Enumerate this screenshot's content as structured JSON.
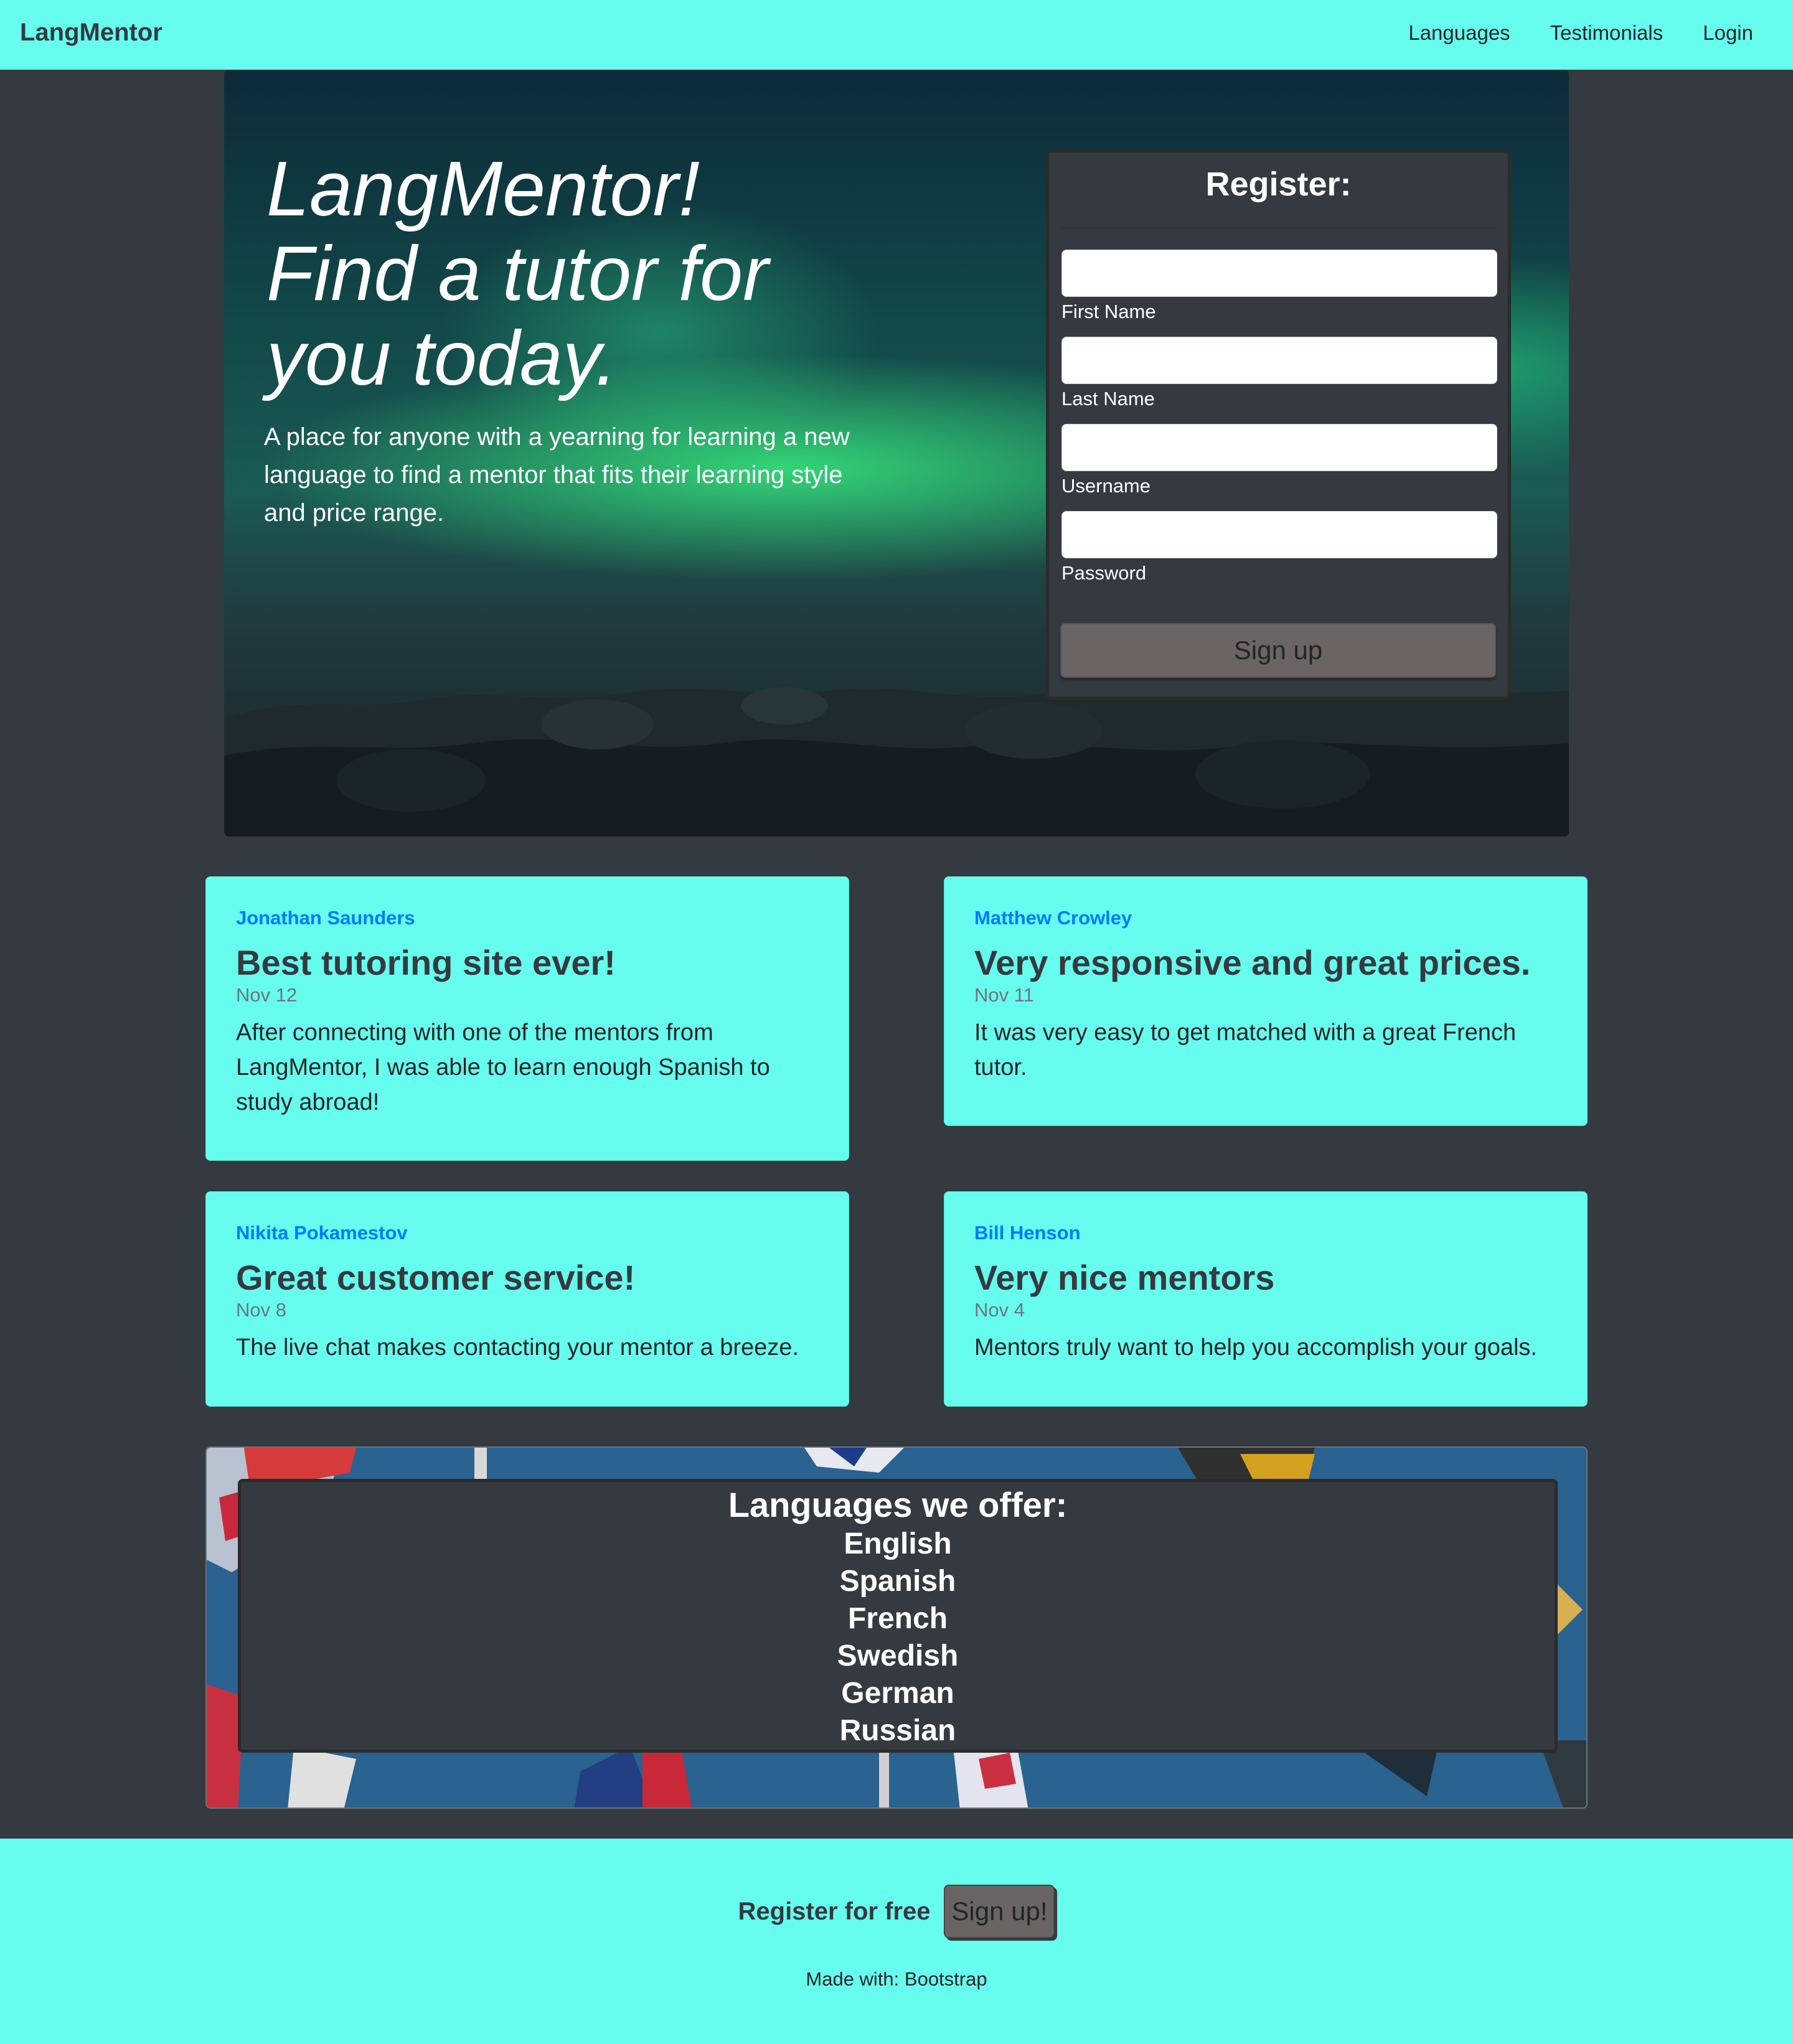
{
  "navbar": {
    "brand": "LangMentor",
    "links": [
      "Languages",
      "Testimonials",
      "Login"
    ]
  },
  "hero": {
    "title": "LangMentor! Find a tutor for you today.",
    "subtitle": "A place for anyone with a yearning for learning a new language to find a mentor that fits their learning style and price range."
  },
  "register": {
    "title": "Register:",
    "fields": [
      "First Name",
      "Last Name",
      "Username",
      "Password"
    ],
    "button": "Sign up"
  },
  "testimonials": [
    {
      "author": "Jonathan Saunders",
      "title": "Best tutoring site ever!",
      "date": "Nov 12",
      "text": "After connecting with one of the mentors from LangMentor, I was able to learn enough Spanish to study abroad!"
    },
    {
      "author": "Matthew Crowley",
      "title": "Very responsive and great prices.",
      "date": "Nov 11",
      "text": "It was very easy to get matched with a great French tutor."
    },
    {
      "author": "Nikita Pokamestov",
      "title": "Great customer service!",
      "date": "Nov 8",
      "text": "The live chat makes contacting your mentor a breeze."
    },
    {
      "author": "Bill Henson",
      "title": "Very nice mentors",
      "date": "Nov 4",
      "text": "Mentors truly want to help you accomplish your goals."
    }
  ],
  "languages": {
    "title": "Languages we offer:",
    "items": [
      "English",
      "Spanish",
      "French",
      "Swedish",
      "German",
      "Russian"
    ]
  },
  "footer": {
    "cta_text": "Register for free",
    "cta_button": "Sign up!",
    "credit": "Made with: Bootstrap"
  },
  "colors": {
    "accent": "#66fdee",
    "dark": "#343a40",
    "button": "#6a6564",
    "link": "#007bff"
  }
}
